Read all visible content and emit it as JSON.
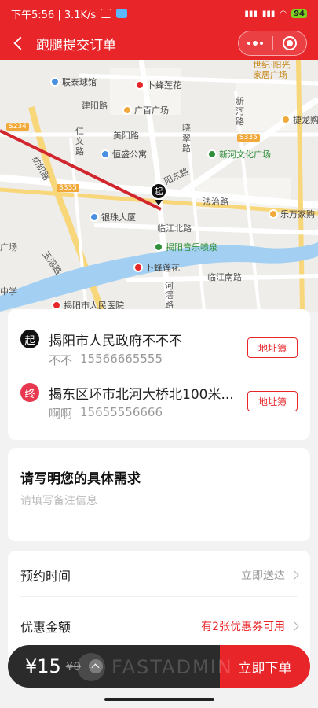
{
  "status_bar": {
    "time_speed": "下午5:56 | 3.1K/s",
    "battery": "94"
  },
  "header": {
    "title": "跑腿提交订单"
  },
  "map": {
    "pin_label": "起",
    "labels": {
      "lianjia": "联泰球馆",
      "bufeng1": "卜蜂莲花",
      "shijiyangguang": "世纪·阳光\n家居广场",
      "jianyang": "建阳路",
      "guangbai": "广百广场",
      "xinhe_road": "新\n河\n路",
      "jiefang": "捷龙购",
      "renyi": "仁\n义\n路",
      "meiyang": "美阳路",
      "hengsheng": "恒盛公寓",
      "xiaocui": "晓\n翠\n路",
      "xinhe_plaza": "新河文化广场",
      "yangdong": "阳东路",
      "fangzhi": "纺织路",
      "yinzhu": "银珠大厦",
      "fazhi": "法治路",
      "lewan": "乐万家购",
      "linjiangbei": "临江北路",
      "music_fountain": "揭阳音乐喷泉",
      "yujin": "玉滘路",
      "bufeng2": "卜蜂莲花",
      "linjiangnan": "临江南路",
      "zhongxue": "中学",
      "hengjiao": "河\n滘\n路",
      "hospital": "揭阳市人民医院",
      "guang": "广场"
    },
    "road_badges": {
      "s234": "S234",
      "s335a": "S335",
      "s335b": "S335"
    }
  },
  "addresses": [
    {
      "badge": "起",
      "title": "揭阳市人民政府不不不",
      "name": "不不",
      "phone": "15566665555",
      "book_label": "地址簿"
    },
    {
      "badge": "终",
      "title": "揭东区环市北河大桥北100米...",
      "name": "啊啊",
      "phone": "15655556666",
      "book_label": "地址簿"
    }
  ],
  "requirements": {
    "title": "请写明您的具体需求",
    "placeholder": "请填写备注信息"
  },
  "options": {
    "time_label": "预约时间",
    "time_value": "立即送达",
    "discount_label": "优惠金额",
    "discount_value": "有2张优惠券可用"
  },
  "footer": {
    "price_now": "¥15",
    "price_old": "¥0",
    "watermark": "FASTADMIN",
    "submit_label": "立即下单"
  },
  "colors": {
    "brand_red": "#e8262a",
    "end_badge": "#e8384f",
    "footer_dark": "#2b2b2b"
  }
}
